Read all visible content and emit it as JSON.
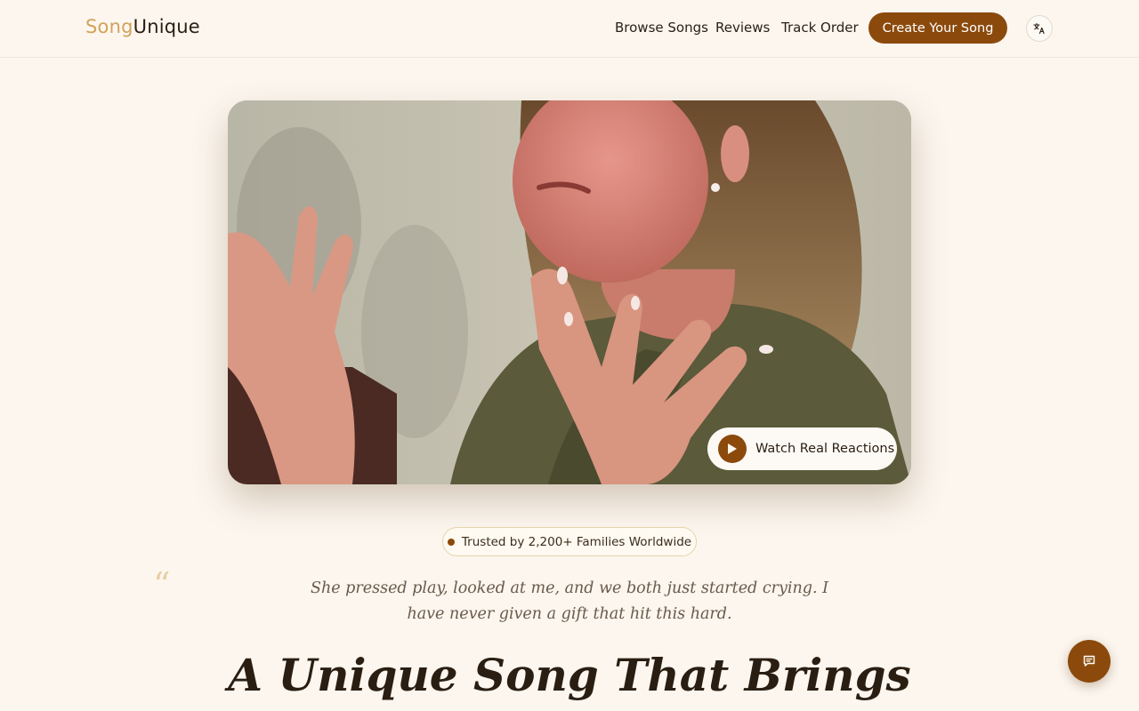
{
  "brand": {
    "part1": "Song",
    "part2": "Unique"
  },
  "nav": {
    "browse": "Browse Songs",
    "reviews": "Reviews",
    "track": "Track Order",
    "cta": "Create Your Song"
  },
  "icons": {
    "language": "language-icon",
    "play": "play-icon",
    "chat": "chat-icon"
  },
  "video": {
    "button_label": "Watch Real Reactions"
  },
  "trust": {
    "label": "Trusted by 2,200+ Families Worldwide"
  },
  "testimonial": {
    "quote": "She pressed play, looked at me, and we both just started crying. I have never given a gift that hit this hard."
  },
  "hero": {
    "headline": "A Unique Song That Brings"
  },
  "colors": {
    "accent": "#8b4a0c",
    "logo_accent": "#d2a259",
    "background": "#fcf6ef"
  }
}
